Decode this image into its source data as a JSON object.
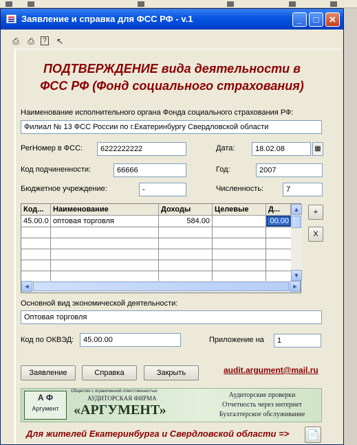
{
  "window": {
    "title": "Заявление и справка для ФСС РФ - v.1",
    "min": "_",
    "max": "□",
    "close": "✕"
  },
  "heading": {
    "line1": "ПОДТВЕРЖДЕНИЕ вида деятельности в",
    "line2": "ФСС РФ (Фонд социального страхования)"
  },
  "organ": {
    "label": "Наименование исполнительного органа Фонда социального страхования РФ:",
    "value": "Филиал № 13 ФСС России по г.Екатеринбургу Свердловской области"
  },
  "regnomer": {
    "label": "РегНомер в ФСС:",
    "value": "6222222222"
  },
  "date": {
    "label": "Дата:",
    "value": "18.02.08"
  },
  "kod_podch": {
    "label": "Код подчиненности:",
    "value": "66666"
  },
  "year": {
    "label": "Год:",
    "value": "2007"
  },
  "budget": {
    "label": "Бюджетное учреждение:",
    "value": "-"
  },
  "count": {
    "label": "Численность:",
    "value": "7"
  },
  "table": {
    "headers": [
      "Код...",
      "Наименование",
      "Доходы",
      "Целевые",
      "Д..."
    ],
    "rows": [
      [
        "45.00.0",
        "оптовая торговля",
        "584.00",
        "",
        "00.00"
      ]
    ]
  },
  "side_buttons": {
    "add": "+",
    "remove": "X"
  },
  "main_activity": {
    "label": "Основной вид экономической деятельности:",
    "value": "Оптовая торговля"
  },
  "okved": {
    "label": "Код по ОКВЭД:",
    "value": "45.00.00"
  },
  "appendix": {
    "label": "Приложение на",
    "value": "1"
  },
  "buttons": {
    "application": "Заявление",
    "certificate": "Справка",
    "close": "Закрыть"
  },
  "email": "audit.argument@mail.ru",
  "logo": {
    "mark_letters": "А Ф",
    "mark_name": "Аргумент",
    "small": "Общество с ограниченной ответственностью",
    "firm": "АУДИТОРСКАЯ ФИРМА",
    "name": "«АРГУМЕНТ»",
    "services": [
      "Аудиторские проверки",
      "Отчетность через интернет",
      "Бухгалтерское обслуживание"
    ]
  },
  "footer": "Для жителей Екатеринбурга и Свердловской области =>",
  "colors": {
    "accent": "#8b0000",
    "titlebar": "#0a58e0"
  }
}
